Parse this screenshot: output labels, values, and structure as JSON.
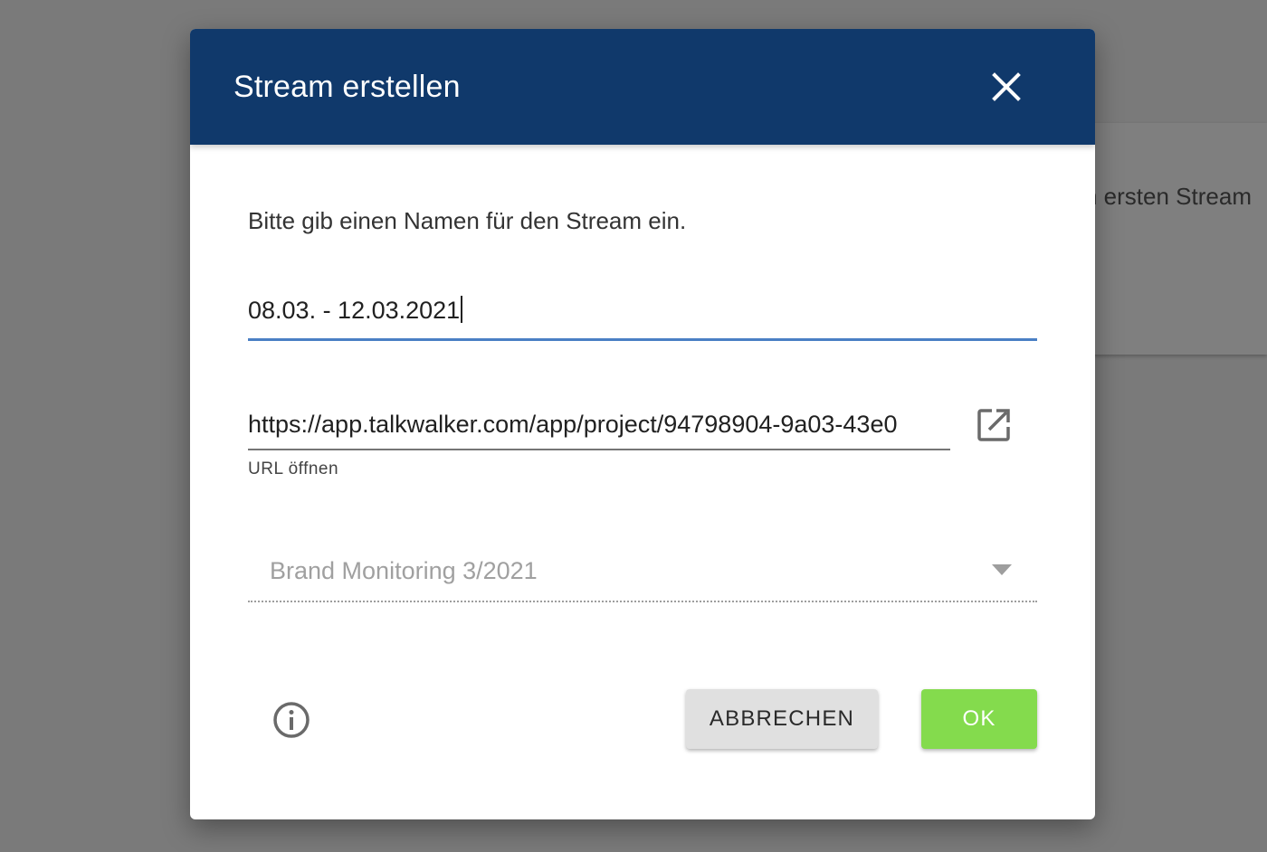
{
  "background": {
    "card_text": "n ersten Stream"
  },
  "dialog": {
    "title": "Stream erstellen",
    "prompt": "Bitte gib einen Namen für den Stream ein.",
    "name_input": {
      "value": "08.03. - 12.03.2021"
    },
    "url_input": {
      "value": "https://app.talkwalker.com/app/project/94798904-9a03-43e0",
      "helper": "URL öffnen"
    },
    "project_select": {
      "selected": "Brand Monitoring 3/2021"
    },
    "buttons": {
      "cancel": "ABBRECHEN",
      "ok": "OK"
    }
  },
  "colors": {
    "header": "#10396b",
    "focus_underline": "#4a7fc4",
    "ok_button": "#84db4d",
    "cancel_button": "#e0e0e0"
  }
}
